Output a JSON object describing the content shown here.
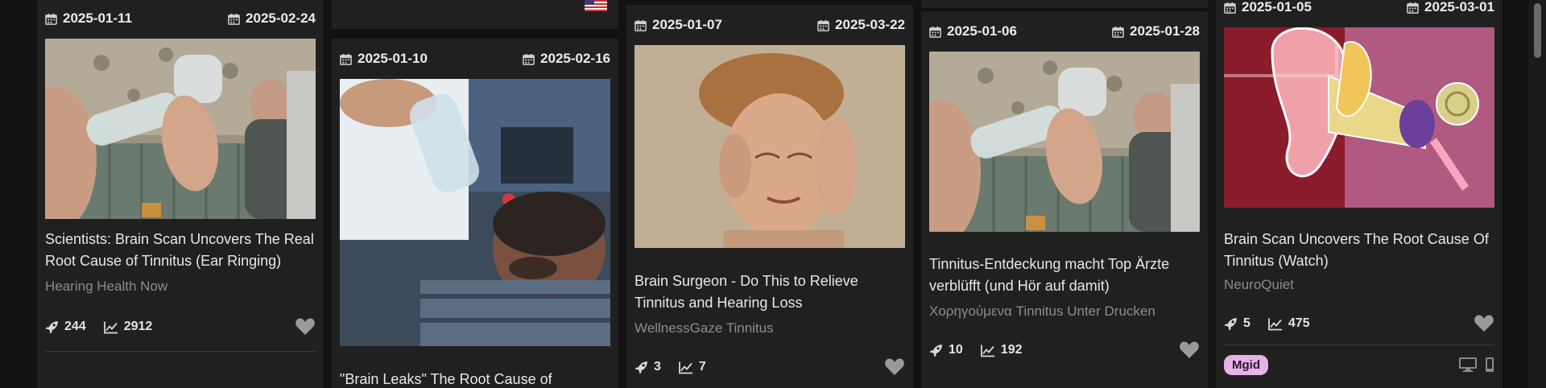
{
  "cards": [
    {
      "date_start": "2025-01-11",
      "date_end": "2025-02-24",
      "title": "Scientists: Brain Scan Uncovers The Real Root Cause of Tinnitus (Ear Ringing)",
      "source": "Hearing Health Now",
      "boosts": "244",
      "views": "2912"
    },
    {
      "date_start": "2025-01-10",
      "date_end": "2025-02-16",
      "title": "\"Brain Leaks\" The Root Cause of",
      "source": "",
      "boosts": "",
      "views": ""
    },
    {
      "date_start": "2025-01-07",
      "date_end": "2025-03-22",
      "title": "Brain Surgeon - Do This to Relieve Tinnitus and Hearing Loss",
      "source": "WellnessGaze Tinnitus",
      "boosts": "3",
      "views": "7"
    },
    {
      "date_start": "2025-01-06",
      "date_end": "2025-01-28",
      "title": "Tinnitus-Entdeckung macht Top Ärzte verblüfft (und Hör auf damit)",
      "source": "Χορηγούμενα Tinnitus Unter Drucken",
      "boosts": "10",
      "views": "192"
    },
    {
      "date_start": "2025-01-05",
      "date_end": "2025-03-01",
      "title": "Brain Scan Uncovers The Root Cause Of Tinnitus (Watch)",
      "source": "NeuroQuiet",
      "boosts": "5",
      "views": "475",
      "network": "Mgid"
    }
  ],
  "icons": {
    "calendar": "calendar-icon",
    "boost": "rocket-icon",
    "views": "chart-line-icon",
    "favorite": "heart-icon",
    "desktop": "desktop-icon",
    "mobile": "mobile-icon",
    "flag": "us-flag-icon"
  },
  "colors": {
    "background": "#121212",
    "card": "#202020",
    "badge": "#e5b3e9"
  }
}
